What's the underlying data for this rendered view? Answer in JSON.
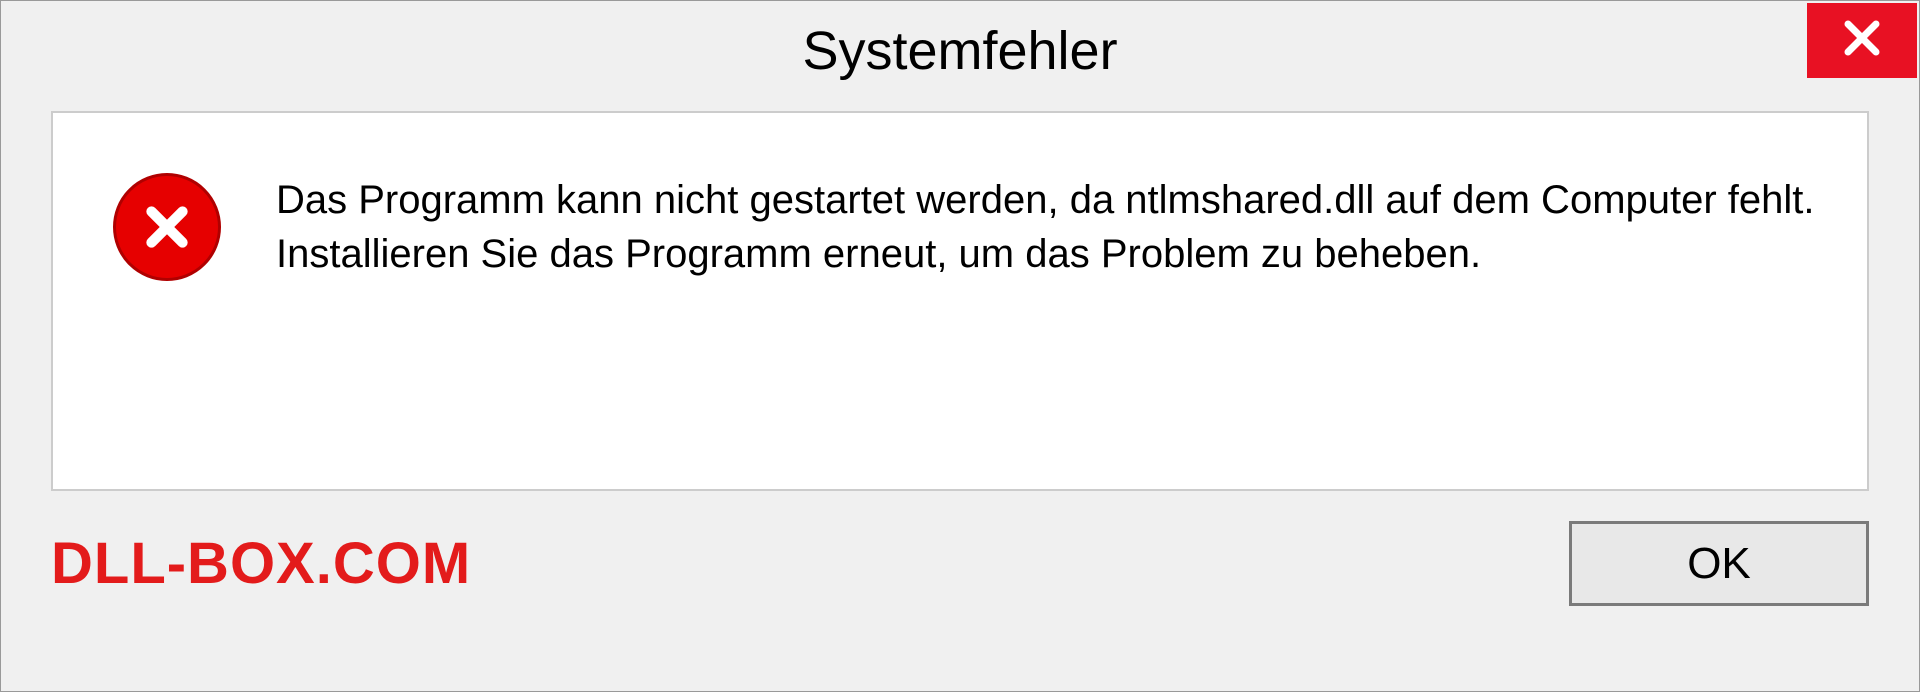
{
  "dialog": {
    "title": "Systemfehler",
    "message": "Das Programm kann nicht gestartet werden, da ntlmshared.dll auf dem Computer fehlt. Installieren Sie das Programm erneut, um das Problem zu beheben.",
    "ok_label": "OK"
  },
  "watermark": "DLL-BOX.COM",
  "colors": {
    "close_bg": "#e81123",
    "error_icon": "#e60000",
    "watermark": "#e31b1b"
  }
}
